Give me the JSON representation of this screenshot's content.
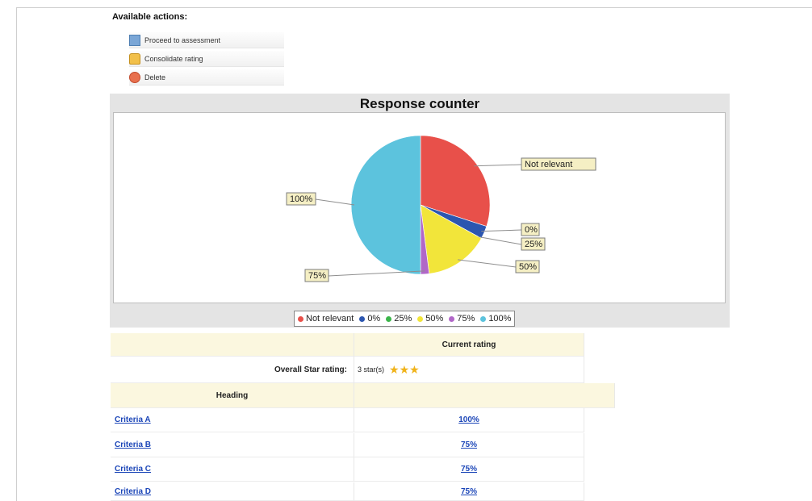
{
  "actions": {
    "title": "Available actions:",
    "items": [
      {
        "label": "Proceed to assessment",
        "icon": "assessment-icon"
      },
      {
        "label": "Consolidate rating",
        "icon": "consolidate-icon"
      },
      {
        "label": "Delete",
        "icon": "delete-icon"
      }
    ]
  },
  "chart_data": {
    "type": "pie",
    "title": "Response counter",
    "categories": [
      "Not relevant",
      "0%",
      "25%",
      "50%",
      "75%",
      "100%"
    ],
    "values": [
      30,
      3,
      0,
      15,
      2,
      50
    ],
    "colors": [
      "#e8504a",
      "#2c56b0",
      "#3bb54a",
      "#f2e53a",
      "#b167c8",
      "#5cc3dd"
    ],
    "slice_labels": [
      "Not relevant",
      "0%",
      "25%",
      "50%",
      "75%",
      "100%"
    ],
    "legend_position": "bottom"
  },
  "table": {
    "current_rating_header": "Current rating",
    "overall_label": "Overall Star rating:",
    "overall_value": "3 star(s)",
    "stars": 3,
    "heading_label": "Heading",
    "rows": [
      {
        "criteria": "Criteria A",
        "rating": "100%"
      },
      {
        "criteria": "Criteria B",
        "rating": "75%"
      },
      {
        "criteria": "Criteria C",
        "rating": "75%"
      },
      {
        "criteria": "Criteria D",
        "rating": "75%"
      }
    ]
  }
}
